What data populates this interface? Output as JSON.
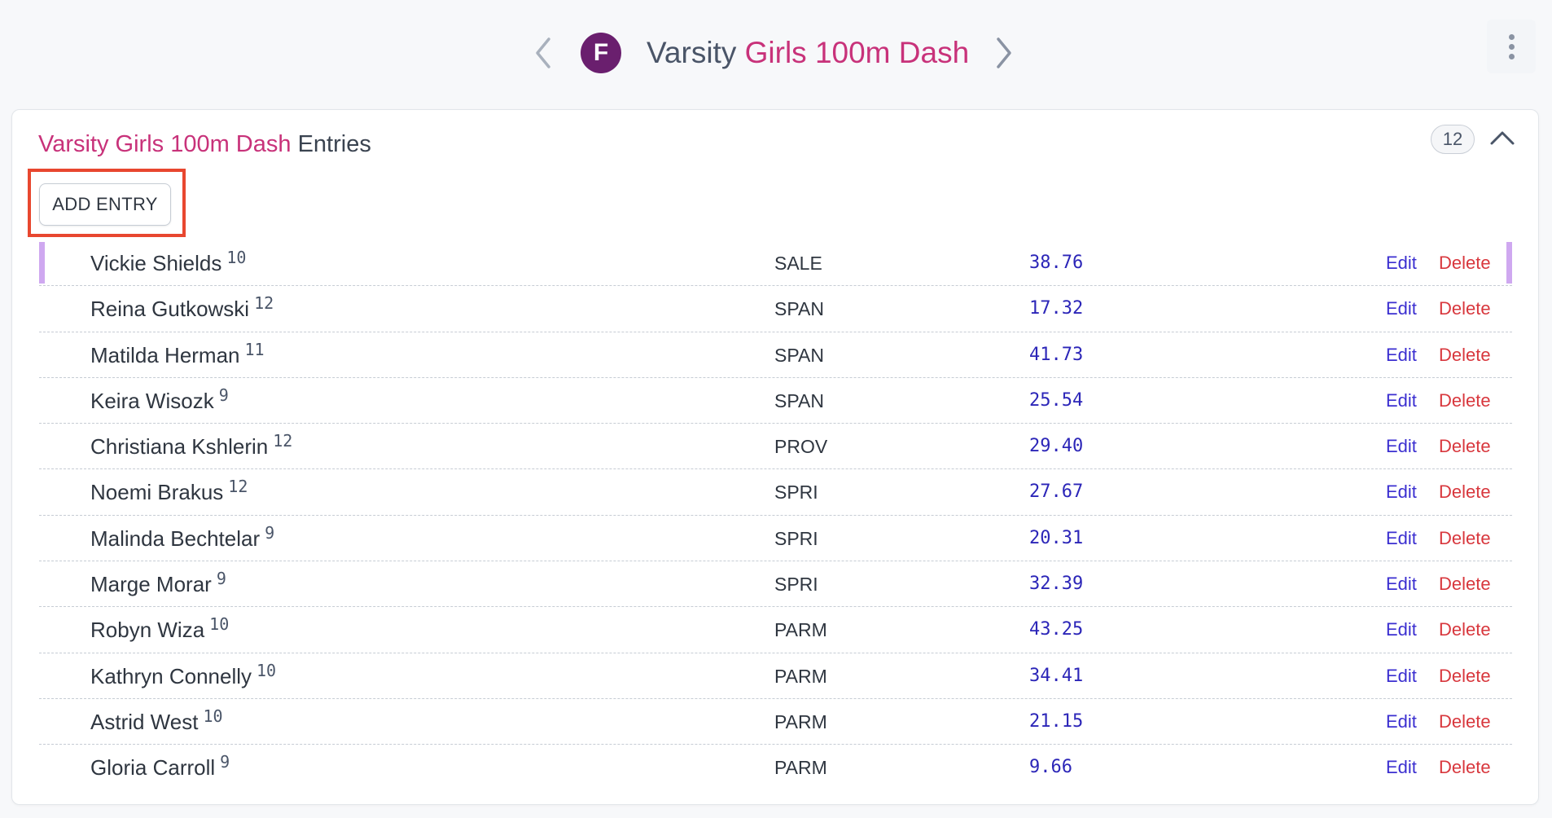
{
  "header": {
    "avatar_letter": "F",
    "title_prefix": "Varsity",
    "title_event": "Girls 100m Dash",
    "prev_icon": "chevron-left-icon",
    "next_icon": "chevron-right-icon",
    "menu_icon": "kebab-menu-icon"
  },
  "card": {
    "title_event": "Varsity Girls 100m Dash",
    "title_suffix": "Entries",
    "entry_count": "12",
    "collapse_icon": "chevron-up-icon",
    "add_entry_label": "ADD ENTRY"
  },
  "colors": {
    "accent": "#c8327a",
    "avatar": "#6a1f6e",
    "mark": "#2c26b8",
    "edit": "#3b2fd0",
    "delete": "#d8373d",
    "selection": "#cfa8f0",
    "annotation": "#e8472f"
  },
  "actions": {
    "edit_label": "Edit",
    "delete_label": "Delete"
  },
  "entries": [
    {
      "name": "Vickie Shields",
      "grade": "10",
      "school": "SALE",
      "mark": "38.76"
    },
    {
      "name": "Reina Gutkowski",
      "grade": "12",
      "school": "SPAN",
      "mark": "17.32"
    },
    {
      "name": "Matilda Herman",
      "grade": "11",
      "school": "SPAN",
      "mark": "41.73"
    },
    {
      "name": "Keira Wisozk",
      "grade": "9",
      "school": "SPAN",
      "mark": "25.54"
    },
    {
      "name": "Christiana Kshlerin",
      "grade": "12",
      "school": "PROV",
      "mark": "29.40"
    },
    {
      "name": "Noemi Brakus",
      "grade": "12",
      "school": "SPRI",
      "mark": "27.67"
    },
    {
      "name": "Malinda Bechtelar",
      "grade": "9",
      "school": "SPRI",
      "mark": "20.31"
    },
    {
      "name": "Marge Morar",
      "grade": "9",
      "school": "SPRI",
      "mark": "32.39"
    },
    {
      "name": "Robyn Wiza",
      "grade": "10",
      "school": "PARM",
      "mark": "43.25"
    },
    {
      "name": "Kathryn Connelly",
      "grade": "10",
      "school": "PARM",
      "mark": "34.41"
    },
    {
      "name": "Astrid West",
      "grade": "10",
      "school": "PARM",
      "mark": "21.15"
    },
    {
      "name": "Gloria Carroll",
      "grade": "9",
      "school": "PARM",
      "mark": "9.66"
    }
  ]
}
